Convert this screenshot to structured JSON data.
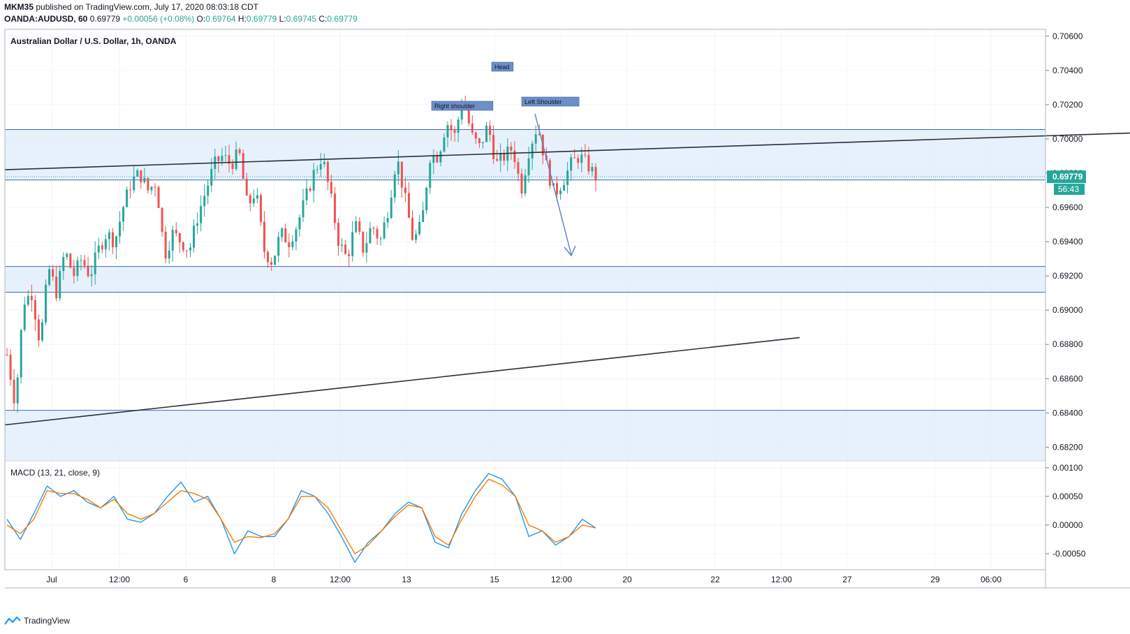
{
  "header": {
    "publisher": "MKM35",
    "published_text": "published on TradingView.com, July 17, 2020 08:03:18 CDT",
    "symbol": "OANDA:AUDUSD, 60",
    "last": "0.69779",
    "change": "+0.00056 (+0.08%)",
    "o_label": "O:",
    "o_val": "0.69764",
    "h_label": "H:",
    "h_val": "0.69779",
    "l_label": "L:",
    "l_val": "0.69745",
    "c_label": "C:",
    "c_val": "0.69779"
  },
  "footer": {
    "brand": "TradingView"
  },
  "colors": {
    "up": "#26a69a",
    "down": "#ef5350",
    "zone_fill": "#e3eefb",
    "zone_line": "#3d6fb0",
    "trend": "#2a2e39",
    "macd": "#2196f3",
    "signal": "#f57c00",
    "arrow": "#5a7fc2",
    "label_bg": "#6d8fc8",
    "price_badge": "#26a69a"
  },
  "chart_data": [
    {
      "type": "candlestick",
      "title": "Australian Dollar / U.S. Dollar, 1h, OANDA",
      "x_tick_labels": [
        "Jul",
        "12:00",
        "6",
        "8",
        "12:00",
        "13",
        "15",
        "12:00",
        "20",
        "22",
        "12:00",
        "27",
        "29",
        "06:00"
      ],
      "y_tick_labels": [
        "0.70600",
        "0.70400",
        "0.70200",
        "0.70000",
        "0.69800",
        "0.69600",
        "0.69400",
        "0.69200",
        "0.69000",
        "0.68800",
        "0.68600",
        "0.68400",
        "0.68200"
      ],
      "ylim": [
        0.6812,
        0.7064
      ],
      "current_price": "0.69779",
      "countdown": "56:43",
      "price_path": [
        0.6874,
        0.6845,
        0.6905,
        0.691,
        0.688,
        0.6925,
        0.691,
        0.6935,
        0.692,
        0.693,
        0.692,
        0.6935,
        0.6945,
        0.694,
        0.696,
        0.6975,
        0.698,
        0.697,
        0.6975,
        0.6932,
        0.6945,
        0.694,
        0.6935,
        0.6955,
        0.697,
        0.6985,
        0.699,
        0.6985,
        0.6992,
        0.696,
        0.697,
        0.6935,
        0.6928,
        0.6945,
        0.694,
        0.695,
        0.6965,
        0.698,
        0.699,
        0.6967,
        0.694,
        0.693,
        0.695,
        0.6935,
        0.695,
        0.694,
        0.696,
        0.699,
        0.6965,
        0.694,
        0.695,
        0.699,
        0.699,
        0.701,
        0.7002,
        0.7025,
        0.7002,
        0.6995,
        0.7008,
        0.6985,
        0.699,
        0.6995,
        0.697,
        0.6995,
        0.7008,
        0.6985,
        0.6968,
        0.6975,
        0.6985,
        0.699,
        0.6985,
        0.6978
      ],
      "zones": [
        {
          "top": 0.70055,
          "bottom": 0.6976
        },
        {
          "top": 0.69255,
          "bottom": 0.69105
        },
        {
          "top": 0.68415,
          "bottom": 0.6812
        }
      ],
      "trendlines": [
        {
          "from": [
            "2020-07-01 00:00",
            0.6982
          ],
          "to": [
            "2020-07-28 00:00",
            0.70055
          ]
        },
        {
          "from": [
            "2020-07-01 00:00",
            0.6833
          ],
          "to": [
            "2020-07-18 00:00",
            0.6884
          ]
        }
      ],
      "annotations": [
        {
          "text": "Head"
        },
        {
          "text": "Right shoulder"
        },
        {
          "text": "Left Shoulder"
        }
      ]
    },
    {
      "type": "line",
      "title": "MACD (13, 21, close, 9)",
      "y_tick_labels": [
        "0.00100",
        "0.00050",
        "0.00000",
        "-0.00050"
      ],
      "ylim": [
        -0.00078,
        0.00112
      ],
      "series": [
        {
          "values": [
            0.0001,
            -0.00025,
            0.0002,
            0.00068,
            0.0005,
            0.0006,
            0.0004,
            0.0003,
            0.0005,
            0.0001,
            5e-05,
            0.0002,
            0.0005,
            0.00075,
            0.0004,
            0.0005,
            0.0001,
            -0.0005,
            -0.0001,
            -0.0002,
            -0.0002,
            0.0001,
            0.0006,
            0.0005,
            0.0002,
            -0.0002,
            -0.00065,
            -0.0003,
            -0.0001,
            0.0002,
            0.0004,
            0.0003,
            -0.0003,
            -0.0004,
            0.0002,
            0.0006,
            0.0009,
            0.0008,
            0.0005,
            -0.0002,
            -0.0001,
            -0.00035,
            -0.0002,
            0.0001,
            -5e-05
          ]
        },
        {
          "values": [
            0.0,
            -0.00015,
            0.0001,
            0.0006,
            0.00055,
            0.00055,
            0.00045,
            0.0003,
            0.00045,
            0.0002,
            0.0001,
            0.0002,
            0.0004,
            0.0006,
            0.00055,
            0.00045,
            0.0001,
            -0.0003,
            -0.0002,
            -0.00022,
            -0.00015,
            0.0001,
            0.0005,
            0.0005,
            0.0003,
            -0.0001,
            -0.0005,
            -0.00035,
            -0.0001,
            0.00015,
            0.00035,
            0.0003,
            -0.0002,
            -0.00035,
            0.0001,
            0.0005,
            0.0008,
            0.0007,
            0.0005,
            0.0,
            -0.0001,
            -0.0003,
            -0.0002,
            0.0,
            -5e-05
          ]
        }
      ]
    }
  ]
}
